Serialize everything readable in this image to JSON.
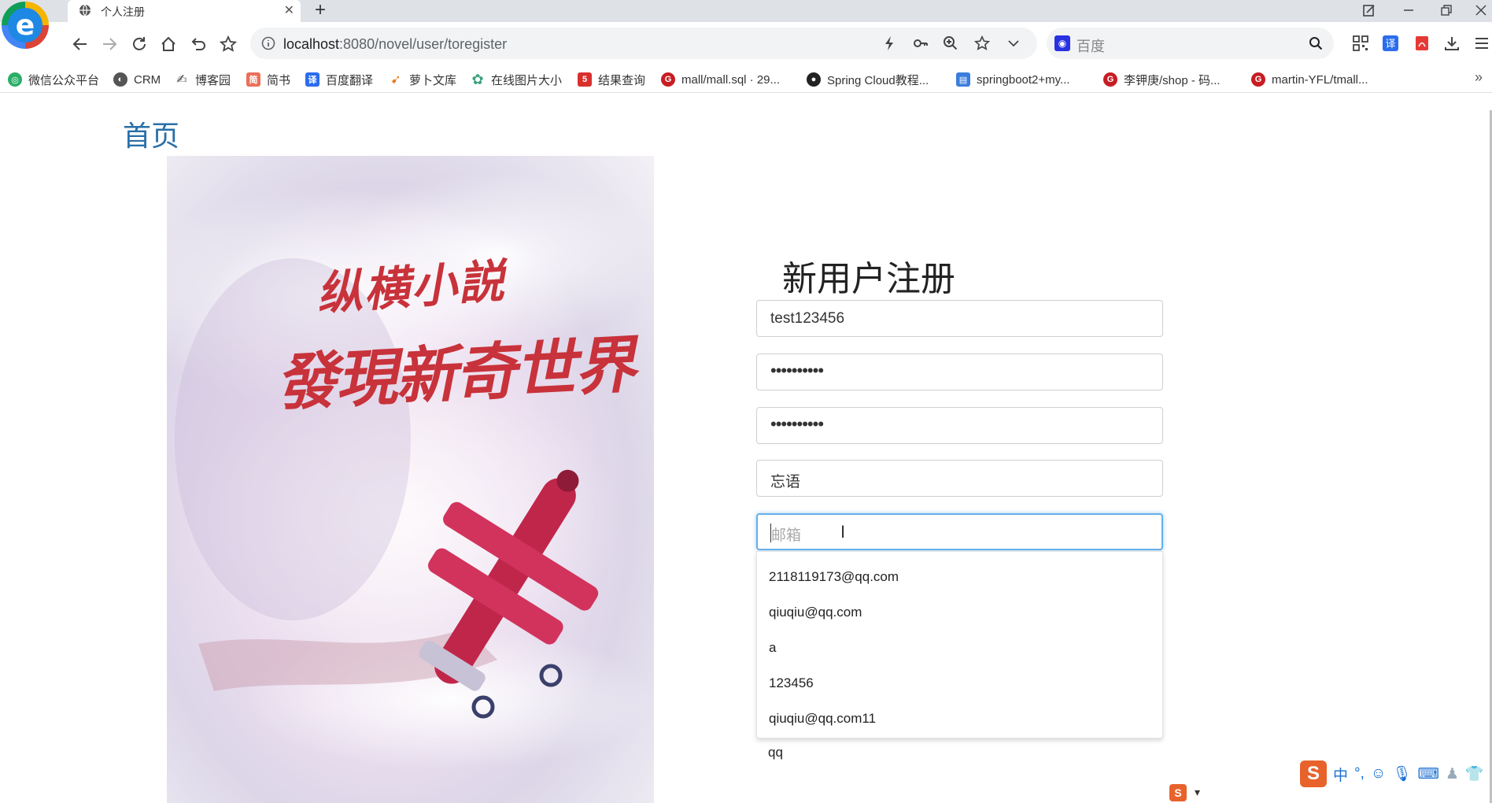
{
  "browser": {
    "tab_title": "个人注册",
    "url_host": "localhost",
    "url_rest": ":8080/novel/user/toregister",
    "search_placeholder": "百度"
  },
  "bookmarks": [
    {
      "label": "微信公众平台",
      "icon": "wechat-icon",
      "color": "#2aae67"
    },
    {
      "label": "CRM",
      "icon": "globe-icon",
      "color": "#555555"
    },
    {
      "label": "博客园",
      "icon": "cnblogs-icon",
      "color": "#444444"
    },
    {
      "label": "简书",
      "icon": "jianshu-icon",
      "color": "#ea6f5a"
    },
    {
      "label": "百度翻译",
      "icon": "baidu-translate-icon",
      "color": "#2b6ded"
    },
    {
      "label": "萝卜文库",
      "icon": "carrot-icon",
      "color": "#e07b20"
    },
    {
      "label": "在线图片大小",
      "icon": "gear-icon",
      "color": "#3aa37a"
    },
    {
      "label": "结果查询",
      "icon": "five-icon",
      "color": "#d9302c"
    },
    {
      "label": "mall/mall.sql · 29...",
      "icon": "gitee-icon",
      "color": "#c71d23"
    },
    {
      "label": "Spring Cloud教程...",
      "icon": "github-icon",
      "color": "#222222"
    },
    {
      "label": "springboot2+my...",
      "icon": "page-icon",
      "color": "#3b7ddd"
    },
    {
      "label": "李钾庚/shop - 码...",
      "icon": "gitee-icon",
      "color": "#c71d23"
    },
    {
      "label": "martin-YFL/tmall...",
      "icon": "gitee-icon",
      "color": "#c71d23"
    }
  ],
  "page": {
    "home_link": "首页",
    "form_title": "新用户注册",
    "hero_slogan_line1": "纵横小説",
    "hero_slogan_line2": "發現新奇世界",
    "fields": {
      "username": "test123456",
      "password_mask": "••••••••••",
      "confirm_mask": "••••••••••",
      "nickname": "忘语",
      "email_placeholder": "邮箱"
    },
    "autocomplete": [
      "2118119173@qq.com",
      "qiuqiu@qq.com",
      "a",
      "123456",
      "qiuqiu@qq.com11",
      "qq"
    ]
  },
  "ime": {
    "logo": "S",
    "mode": "中"
  },
  "colors": {
    "link": "#2a6fa8",
    "focus_border": "#66afe9",
    "slogan_red": "#c8323a"
  }
}
